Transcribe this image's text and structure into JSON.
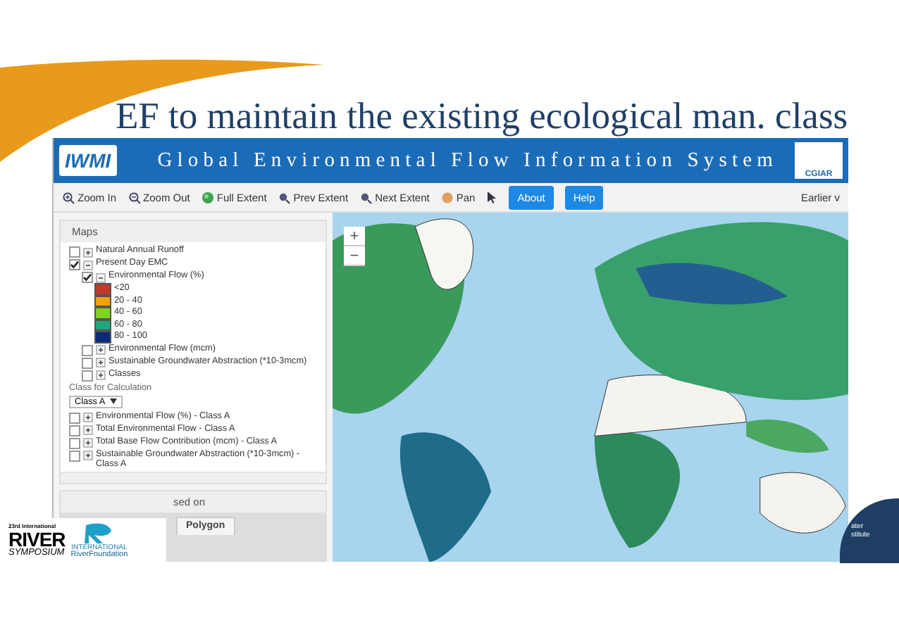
{
  "slide_title": "EF to maintain the existing ecological man. class",
  "app": {
    "logo": "IWMI",
    "title": "Global Environmental Flow Information System",
    "partner_logo": "CGIAR",
    "toolbar": [
      {
        "label": "Zoom In",
        "kind": "zoomin"
      },
      {
        "label": "Zoom Out",
        "kind": "zoomout"
      },
      {
        "label": "Full Extent",
        "kind": "globe"
      },
      {
        "label": "Prev Extent",
        "kind": "prev"
      },
      {
        "label": "Next Extent",
        "kind": "next"
      },
      {
        "label": "Pan",
        "kind": "pan"
      },
      {
        "kind": "pointer"
      },
      {
        "label": "About",
        "kind": "tab"
      },
      {
        "label": "Help",
        "kind": "tab"
      }
    ],
    "toolbar_right": "Earlier v",
    "maps_panel": {
      "title": "Maps",
      "tree": [
        {
          "label": "Natural Annual Runoff",
          "checked": false,
          "expanded": false
        },
        {
          "label": "Present Day EMC",
          "checked": true,
          "expanded": true,
          "children": [
            {
              "label": "Environmental Flow (%)",
              "checked": true,
              "expanded": true,
              "legend": [
                {
                  "label": "<20",
                  "color": "#c0392b"
                },
                {
                  "label": "20 - 40",
                  "color": "#f0a30a"
                },
                {
                  "label": "40 - 60",
                  "color": "#7ed321"
                },
                {
                  "label": "60 - 80",
                  "color": "#1fa67a"
                },
                {
                  "label": "80 - 100",
                  "color": "#0b2a7a"
                }
              ]
            },
            {
              "label": "Environmental Flow (mcm)",
              "checked": false,
              "expanded": false
            },
            {
              "label": "Sustainable Groundwater Abstraction (*10-3mcm)",
              "checked": false,
              "expanded": false
            },
            {
              "label": "Classes",
              "checked": false,
              "expanded": false
            }
          ]
        }
      ],
      "class_label": "Class for Calculation",
      "class_select": "Class A",
      "class_layers": [
        {
          "label": "Environmental Flow (%) - Class A",
          "checked": false,
          "expanded": false
        },
        {
          "label": "Total Environmental Flow - Class A",
          "checked": false,
          "expanded": false
        },
        {
          "label": "Total Base Flow Contribution (mcm) - Class A",
          "checked": false,
          "expanded": false
        },
        {
          "label": "Sustainable Groundwater Abstraction (*10-3mcm) - Class A",
          "checked": false,
          "expanded": false
        }
      ]
    },
    "second_panel": {
      "title": "sed on",
      "tabs": [
        {
          "label": "Polygon"
        }
      ]
    },
    "map": {
      "zoom_in": "+",
      "zoom_out": "−"
    }
  },
  "logos": {
    "symposium_top": "23rd International",
    "symposium_main": "RIVER",
    "symposium_sub": "SYMPOSIUM",
    "foundation_top": "INTERNATIONAL",
    "foundation": "RiverFoundation"
  },
  "corner": {
    "line_1": "ater",
    "line_2": "stitute"
  }
}
